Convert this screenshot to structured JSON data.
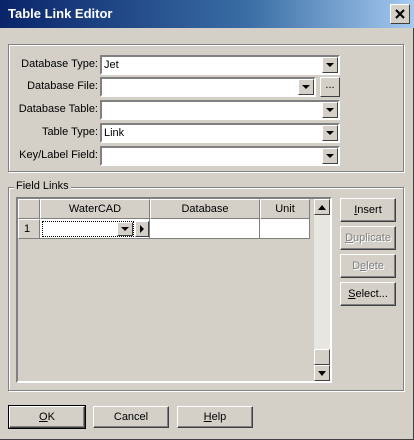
{
  "window": {
    "title": "Table Link Editor"
  },
  "form": {
    "database_type": {
      "label": "Database Type:",
      "value": "Jet"
    },
    "database_file": {
      "label": "Database File:",
      "value": "",
      "browse_label": "..."
    },
    "database_table": {
      "label": "Database Table:",
      "value": ""
    },
    "table_type": {
      "label": "Table Type:",
      "value": "Link"
    },
    "key_label_field": {
      "label": "Key/Label Field:",
      "value": ""
    }
  },
  "field_links": {
    "group_label": "Field Links",
    "columns": [
      "WaterCAD",
      "Database",
      "Unit"
    ],
    "rows": [
      {
        "index": "1",
        "watercad": "",
        "database": "",
        "unit": ""
      }
    ],
    "buttons": {
      "insert": {
        "prefix": "",
        "underline": "I",
        "suffix": "nsert"
      },
      "duplicate": {
        "prefix": "",
        "underline": "D",
        "suffix": "uplicate"
      },
      "delete": {
        "prefix": "D",
        "underline": "e",
        "suffix": "lete"
      },
      "select": {
        "prefix": "",
        "underline": "S",
        "suffix": "elect..."
      }
    }
  },
  "footer": {
    "ok": {
      "prefix": "",
      "underline": "O",
      "suffix": "K"
    },
    "cancel": "Cancel",
    "help": {
      "prefix": "",
      "underline": "H",
      "suffix": "elp"
    }
  }
}
